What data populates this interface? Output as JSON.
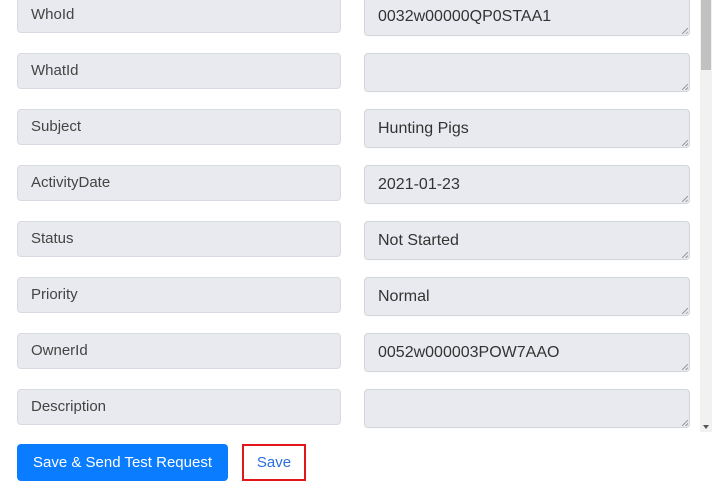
{
  "fields": [
    {
      "label": "WhoId",
      "value": "0032w00000QP0STAA1"
    },
    {
      "label": "WhatId",
      "value": ""
    },
    {
      "label": "Subject",
      "value": "Hunting Pigs"
    },
    {
      "label": "ActivityDate",
      "value": "2021-01-23"
    },
    {
      "label": "Status",
      "value": "Not Started"
    },
    {
      "label": "Priority",
      "value": "Normal"
    },
    {
      "label": "OwnerId",
      "value": "0052w000003POW7AAO"
    },
    {
      "label": "Description",
      "value": ""
    }
  ],
  "buttons": {
    "save_send": "Save & Send Test Request",
    "save": "Save"
  },
  "colors": {
    "primary": "#0a7cff",
    "highlight": "#e4141b"
  }
}
